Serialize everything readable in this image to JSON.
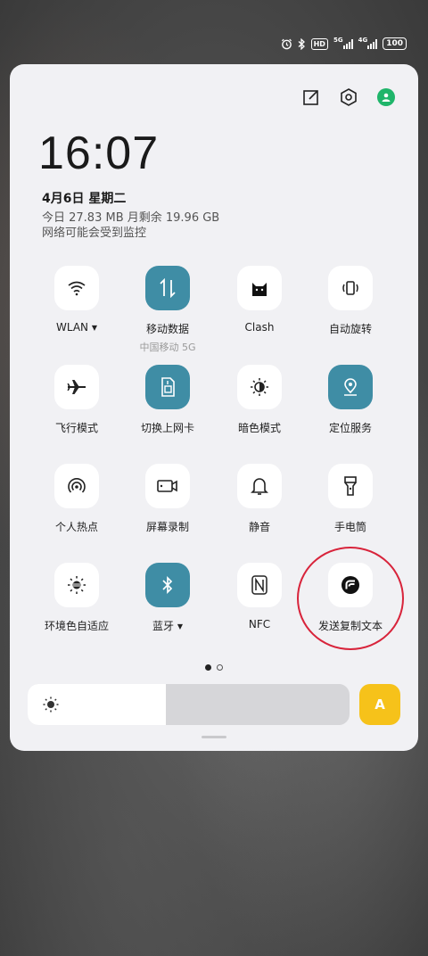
{
  "status_bar": {
    "hd_label": "HD",
    "net1_label": "5G",
    "net2_label": "4G",
    "battery_label": "100"
  },
  "panel": {
    "time": "16:07",
    "date": "4月6日  星期二",
    "usage": "今日 27.83 MB 月剩余 19.96 GB",
    "monitor_note": "网络可能会受到监控"
  },
  "tiles": [
    {
      "label": "WLAN",
      "icon": "wifi-icon",
      "active": false
    },
    {
      "label": "移动数据",
      "sub": "中国移动 5G",
      "icon": "mobile-data-icon",
      "active": true
    },
    {
      "label": "Clash",
      "icon": "cat-icon",
      "active": false
    },
    {
      "label": "自动旋转",
      "icon": "rotate-icon",
      "active": false
    },
    {
      "label": "飞行模式",
      "icon": "airplane-icon",
      "active": false
    },
    {
      "label": "切换上网卡",
      "icon": "sim-card-icon",
      "active": true
    },
    {
      "label": "暗色模式",
      "icon": "dark-mode-icon",
      "active": false
    },
    {
      "label": "定位服务",
      "icon": "location-icon",
      "active": true
    },
    {
      "label": "个人热点",
      "icon": "hotspot-icon",
      "active": false
    },
    {
      "label": "屏幕录制",
      "icon": "screen-record-icon",
      "active": false
    },
    {
      "label": "静音",
      "icon": "bell-icon",
      "active": false
    },
    {
      "label": "手电筒",
      "icon": "flashlight-icon",
      "active": false
    },
    {
      "label": "环境色自适应",
      "icon": "ambient-color-icon",
      "active": false
    },
    {
      "label": "蓝牙",
      "icon": "bluetooth-icon",
      "active": true
    },
    {
      "label": "NFC",
      "icon": "nfc-icon",
      "active": false
    },
    {
      "label": "发送复制文本",
      "icon": "send-copy-text-icon",
      "active": false
    }
  ],
  "pager": {
    "pages": 2,
    "current": 1
  },
  "brightness": {
    "level": 0.43
  },
  "auto_brightness_label": "A",
  "colors": {
    "active_tile": "#3f8da5",
    "auto_button": "#f6c21a",
    "highlight_ring": "#d8243b",
    "avatar": "#1fb56a"
  }
}
